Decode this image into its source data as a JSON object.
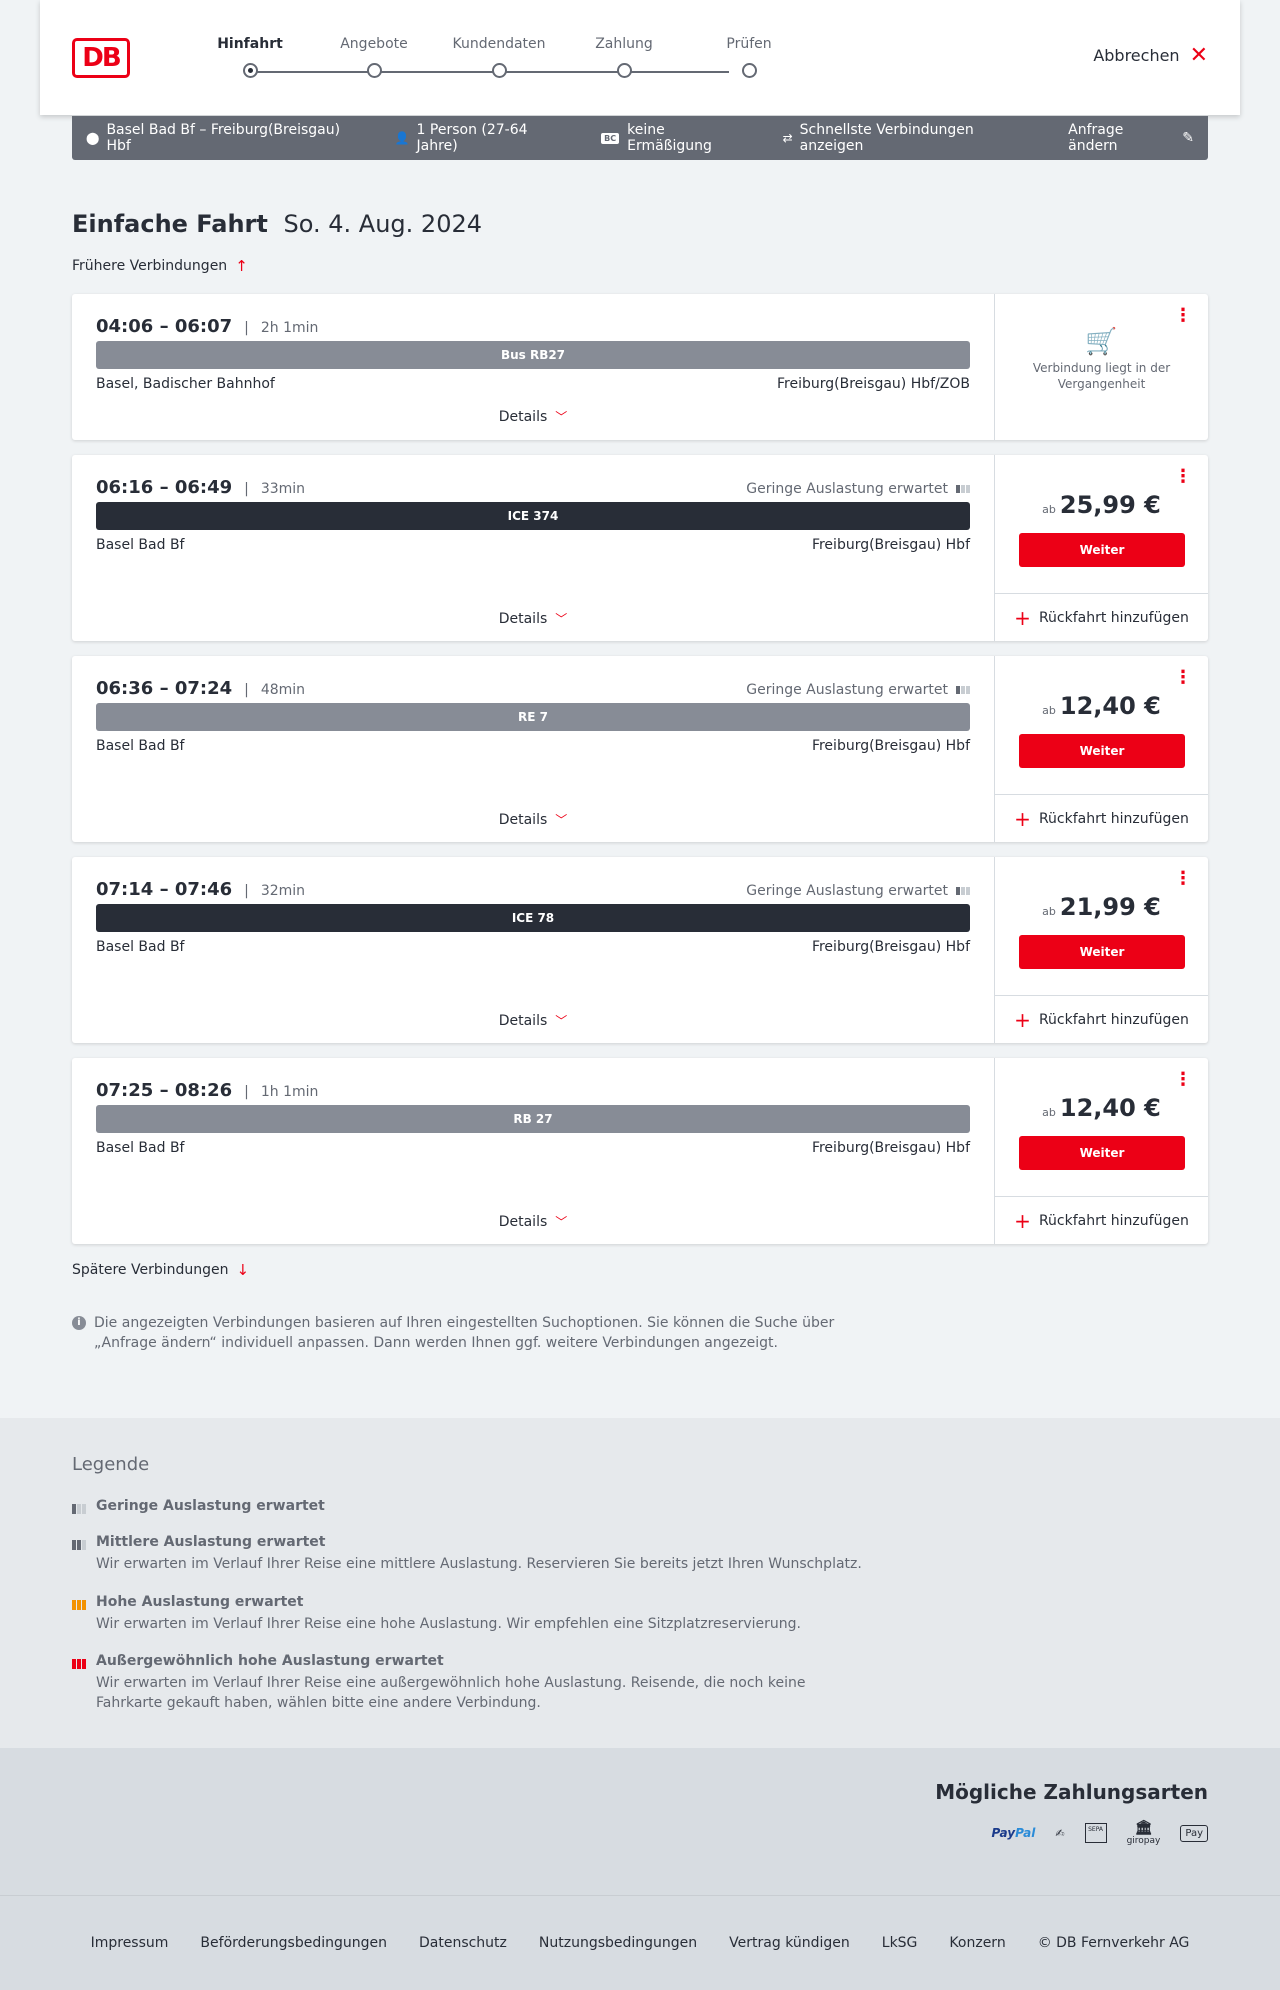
{
  "header": {
    "logo": "DB",
    "steps": [
      "Hinfahrt",
      "Angebote",
      "Kundendaten",
      "Zahlung",
      "Prüfen"
    ],
    "cancel_label": "Abbrechen"
  },
  "infobar": {
    "route": "Basel Bad Bf – Freiburg(Breisgau) Hbf",
    "passengers": "1 Person (27-64 Jahre)",
    "bc_badge": "BC",
    "discount": "keine Ermäßigung",
    "fastest": "Schnellste Verbindungen anzeigen",
    "change": "Anfrage ändern"
  },
  "title": {
    "trip": "Einfache Fahrt",
    "date": "So. 4. Aug. 2024"
  },
  "earlier": "Frühere Verbindungen",
  "later": "Spätere Verbindungen",
  "details_label": "Details",
  "weiter_label": "Weiter",
  "return_label": "Rückfahrt hinzufügen",
  "ab_label": "ab",
  "past_label": "Verbindung liegt in der Vergangenheit",
  "connections": [
    {
      "times": "04:06 – 06:07",
      "duration": "2h 1min",
      "occupancy": "",
      "train": "Bus RB27",
      "from": "Basel, Badischer Bahnhof",
      "to": "Freiburg(Breisgau) Hbf/ZOB",
      "price": ""
    },
    {
      "times": "06:16 – 06:49",
      "duration": "33min",
      "occupancy": "Geringe Auslastung erwartet",
      "train": "ICE 374",
      "from": "Basel Bad Bf",
      "to": "Freiburg(Breisgau) Hbf",
      "price": "25,99 €"
    },
    {
      "times": "06:36 – 07:24",
      "duration": "48min",
      "occupancy": "Geringe Auslastung erwartet",
      "train": "RE 7",
      "from": "Basel Bad Bf",
      "to": "Freiburg(Breisgau) Hbf",
      "price": "12,40 €"
    },
    {
      "times": "07:14 – 07:46",
      "duration": "32min",
      "occupancy": "Geringe Auslastung erwartet",
      "train": "ICE 78",
      "from": "Basel Bad Bf",
      "to": "Freiburg(Breisgau) Hbf",
      "price": "21,99 €"
    },
    {
      "times": "07:25 – 08:26",
      "duration": "1h 1min",
      "occupancy": "",
      "train": "RB 27",
      "from": "Basel Bad Bf",
      "to": "Freiburg(Breisgau) Hbf",
      "price": "12,40 €"
    }
  ],
  "note": "Die angezeigten Verbindungen basieren auf Ihren eingestellten Suchoptionen. Sie können die Suche über „Anfrage ändern“ individuell anpassen. Dann werden Ihnen ggf. weitere Verbindungen angezeigt.",
  "legend": {
    "title": "Legende",
    "items": [
      {
        "title": "Geringe Auslastung erwartet",
        "desc": ""
      },
      {
        "title": "Mittlere Auslastung erwartet",
        "desc": "Wir erwarten im Verlauf Ihrer Reise eine mittlere Auslastung. Reservieren Sie bereits jetzt Ihren Wunschplatz."
      },
      {
        "title": "Hohe Auslastung erwartet",
        "desc": "Wir erwarten im Verlauf Ihrer Reise eine hohe Auslastung. Wir empfehlen eine Sitzplatzreservierung."
      },
      {
        "title": "Außergewöhnlich hohe Auslastung erwartet",
        "desc": "Wir erwarten im Verlauf Ihrer Reise eine außergewöhnlich hohe Auslastung. Reisende, die noch keine Fahrkarte gekauft haben, wählen bitte eine andere Verbindung."
      }
    ],
    "colors": {
      "low": "#646973",
      "high": "#f39200",
      "extreme": "#ec0016"
    }
  },
  "payments": {
    "title": "Mögliche Zahlungsarten",
    "paypal_a": "Pay",
    "paypal_b": "Pal",
    "sepa": "SEPA",
    "giropay": "giropay",
    "applepay": "Pay"
  },
  "footer": [
    "Impressum",
    "Beförderungsbedingungen",
    "Datenschutz",
    "Nutzungsbedingungen",
    "Vertrag kündigen",
    "LkSG",
    "Konzern",
    "© DB Fernverkehr AG"
  ],
  "colors": {
    "accent": "#ec0016",
    "dark_train": "#282d37",
    "grey_train": "#878c96"
  }
}
